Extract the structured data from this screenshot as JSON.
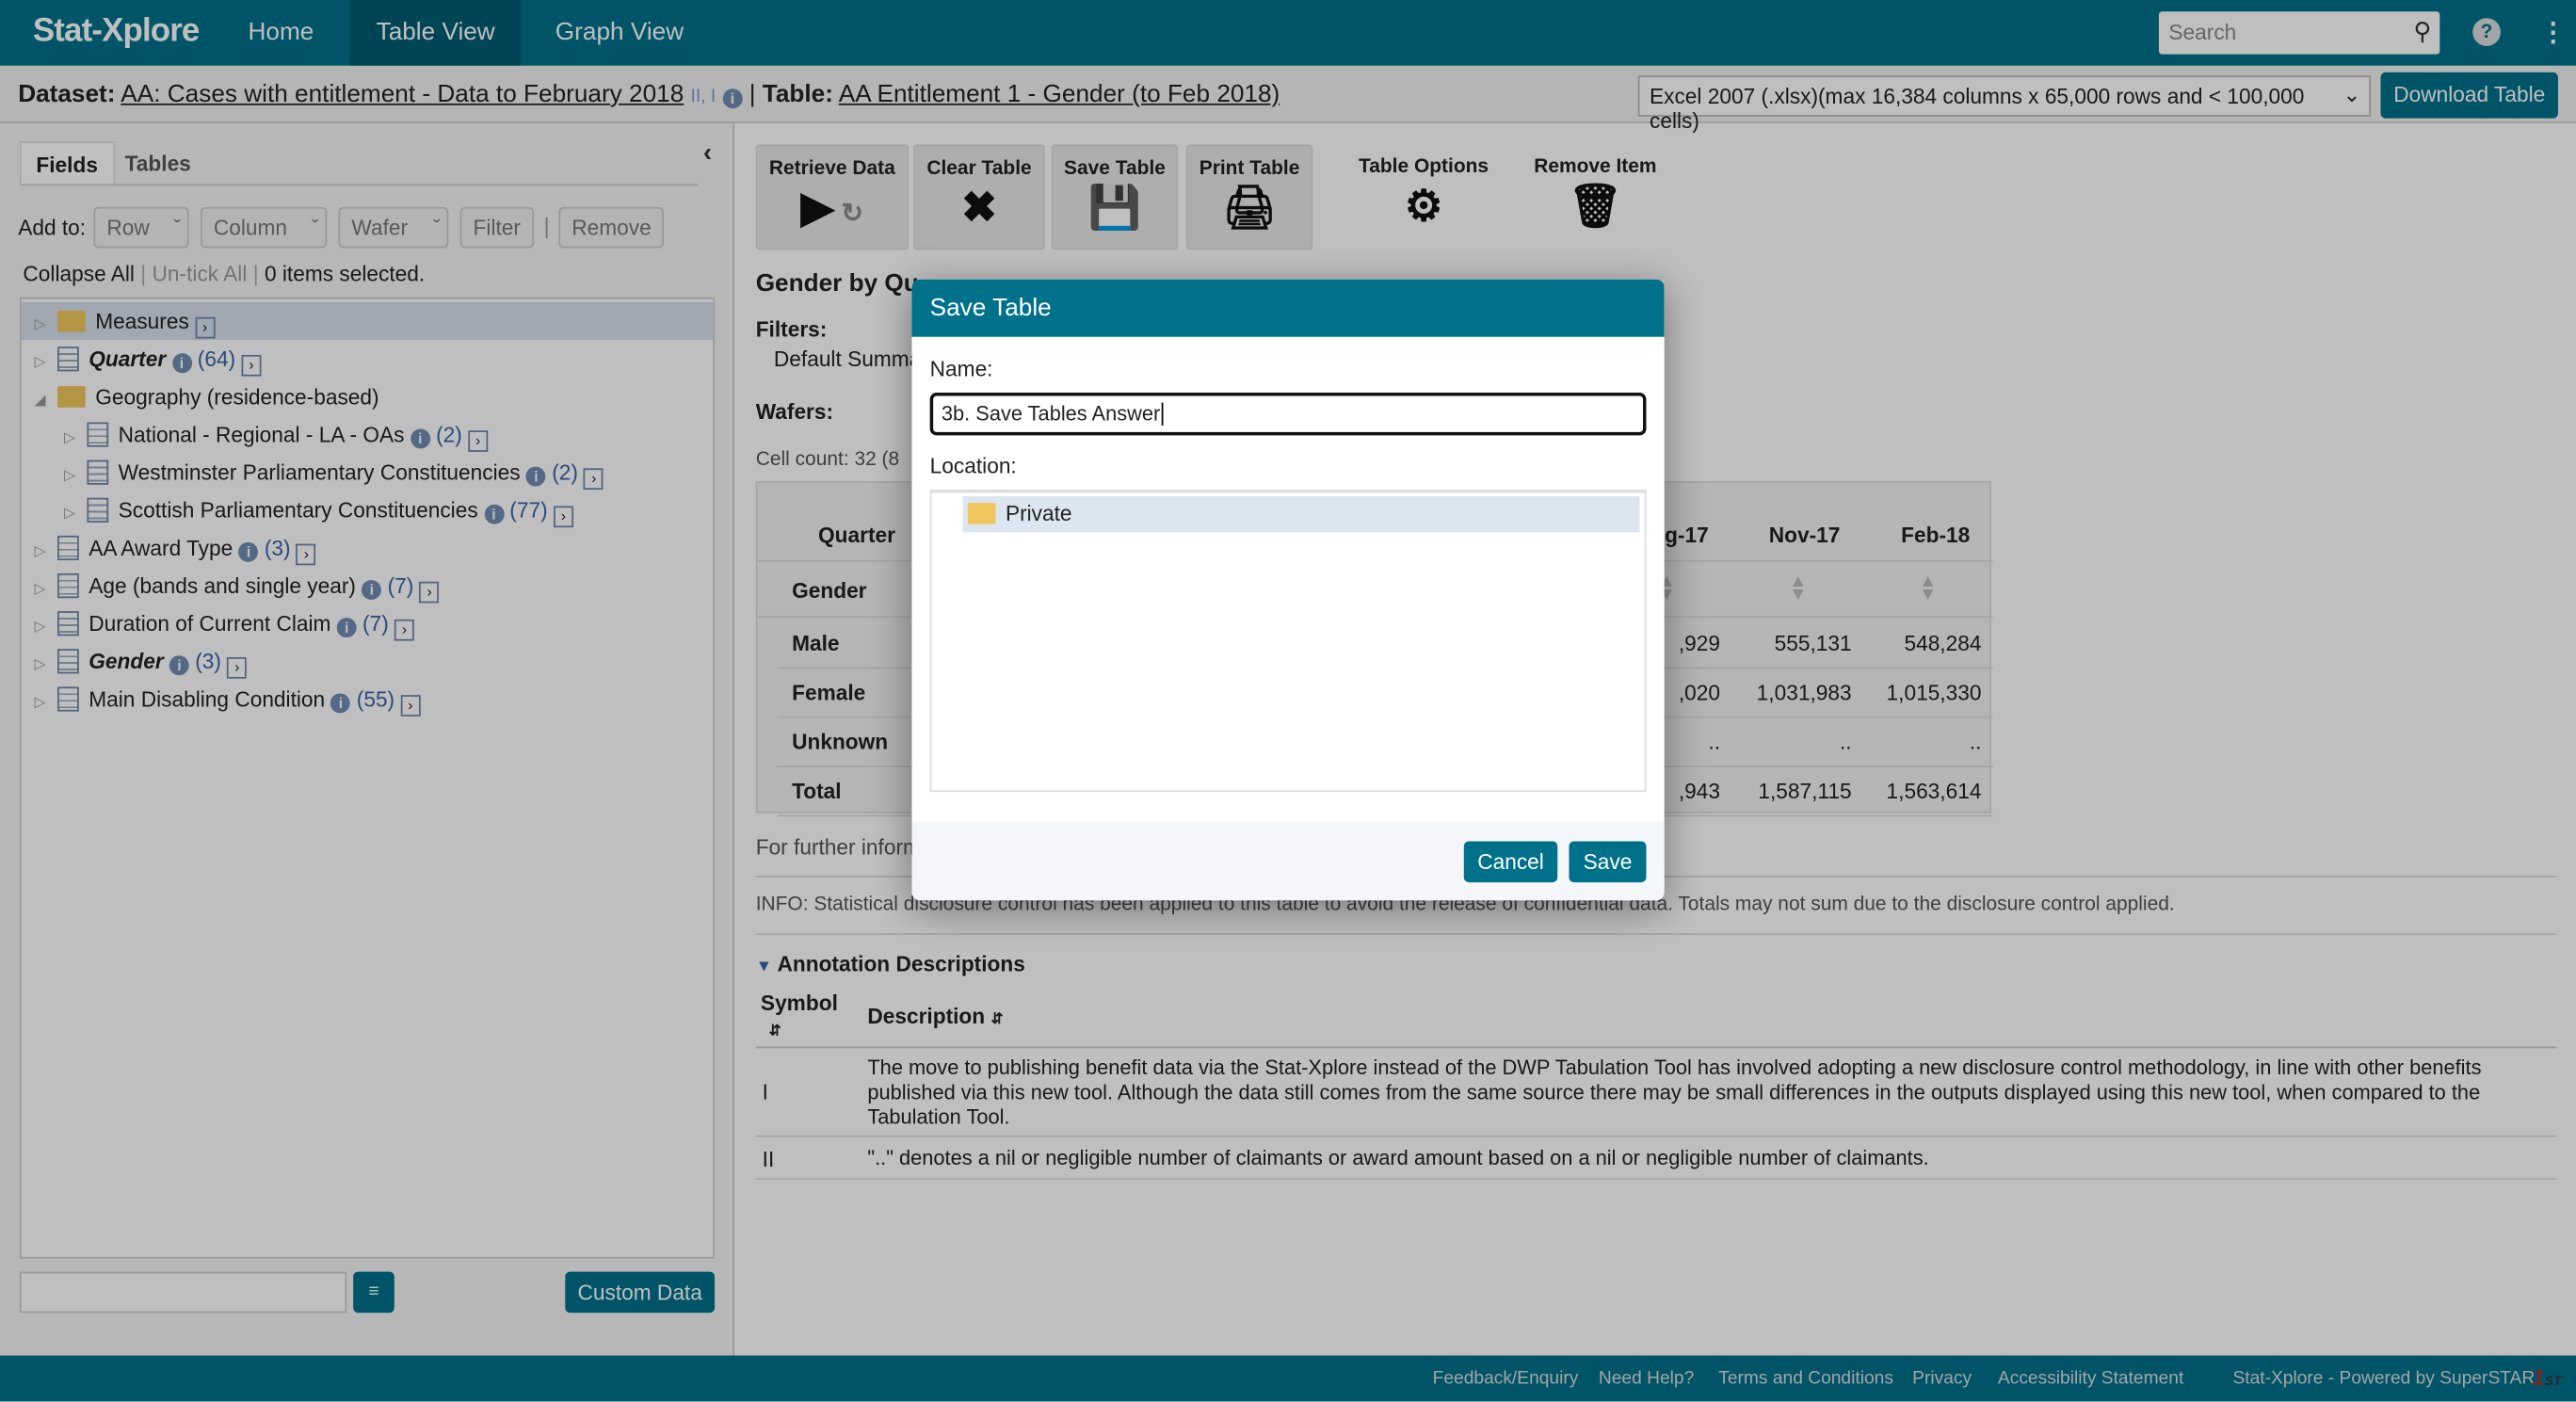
{
  "nav": {
    "logo": "Stat-Xplore",
    "items": [
      "Home",
      "Table View",
      "Graph View"
    ],
    "active": "Table View",
    "search_placeholder": "Search"
  },
  "dataset": {
    "label": "Dataset:",
    "name": "AA: Cases with entitlement - Data to February 2018",
    "annotations": "II, I",
    "table_label": "Table:",
    "table_name": "AA Entitlement 1 - Gender (to Feb 2018)",
    "format": "Excel 2007 (.xlsx)(max 16,384 columns x 65,000 rows and < 100,000 cells)",
    "download": "Download Table"
  },
  "left": {
    "tabs": [
      "Fields",
      "Tables"
    ],
    "add_to": "Add to:",
    "row": "Row",
    "column": "Column",
    "wafer": "Wafer",
    "filter": "Filter",
    "remove": "Remove",
    "collapse_all": "Collapse All",
    "untick_all": "Un-tick All",
    "selected": "0 items selected.",
    "custom_data": "Custom Data",
    "tree": [
      {
        "label": "Measures",
        "type": "measures",
        "level": 0,
        "count": "",
        "info": false,
        "bold": false
      },
      {
        "label": "Quarter",
        "type": "field",
        "level": 0,
        "count": "(64)",
        "info": true,
        "bold": true
      },
      {
        "label": "Geography (residence-based)",
        "type": "folder",
        "level": 0,
        "count": "",
        "info": false,
        "bold": false,
        "expanded": true
      },
      {
        "label": "National - Regional - LA - OAs",
        "type": "field",
        "level": 1,
        "count": "(2)",
        "info": true,
        "bold": false
      },
      {
        "label": "Westminster Parliamentary Constituencies",
        "type": "field",
        "level": 1,
        "count": "(2)",
        "info": true,
        "bold": false
      },
      {
        "label": "Scottish Parliamentary Constituencies",
        "type": "field",
        "level": 1,
        "count": "(77)",
        "info": true,
        "bold": false
      },
      {
        "label": "AA Award Type",
        "type": "field",
        "level": 0,
        "count": "(3)",
        "info": true,
        "bold": false
      },
      {
        "label": "Age (bands and single year)",
        "type": "field",
        "level": 0,
        "count": "(7)",
        "info": true,
        "bold": false
      },
      {
        "label": "Duration of Current Claim",
        "type": "field",
        "level": 0,
        "count": "(7)",
        "info": true,
        "bold": false
      },
      {
        "label": "Gender",
        "type": "field",
        "level": 0,
        "count": "(3)",
        "info": true,
        "bold": true
      },
      {
        "label": "Main Disabling Condition",
        "type": "field",
        "level": 0,
        "count": "(55)",
        "info": true,
        "bold": false
      }
    ]
  },
  "toolbar": [
    "Retrieve Data",
    "Clear Table",
    "Save Table",
    "Print Table",
    "Table Options",
    "Remove Item"
  ],
  "main": {
    "title": "Gender by Qu",
    "filters_label": "Filters:",
    "filters_value": "Default Summa",
    "wafers_label": "Wafers:",
    "cell_count": "Cell count: 32 (8",
    "table": {
      "col_header": "Quarter",
      "row_header": "Gender",
      "columns": [
        "g-17",
        "Nov-17",
        "Feb-18"
      ],
      "rows": [
        {
          "label": "Male",
          "values": [
            ",929",
            "555,131",
            "548,284"
          ]
        },
        {
          "label": "Female",
          "values": [
            ",020",
            "1,031,983",
            "1,015,330"
          ]
        },
        {
          "label": "Unknown",
          "values": [
            "..",
            "..",
            ".."
          ]
        },
        {
          "label": "Total",
          "values": [
            ",943",
            "1,587,115",
            "1,563,614"
          ]
        }
      ]
    },
    "further": "For further inform",
    "info": "INFO: Statistical disclosure control has been applied to this table to avoid the release of confidential data. Totals may not sum due to the disclosure control applied.",
    "annotations_title": "Annotation Descriptions",
    "symbol_header": "Symbol",
    "description_header": "Description",
    "annotations": [
      {
        "symbol": "I",
        "text": "The move to publishing benefit data via the Stat-Xplore instead of the DWP Tabulation Tool has involved adopting a new disclosure control methodology, in line with other benefits published via this new tool. Although the data still comes from the same source there may be small differences in the outputs displayed using this new tool, when compared to the Tabulation Tool."
      },
      {
        "symbol": "II",
        "text": "\"..\" denotes a nil or negligible number of claimants or award amount based on a nil or negligible number of claimants."
      }
    ]
  },
  "dialog": {
    "title": "Save Table",
    "name_label": "Name:",
    "name_value": "3b. Save Tables Answer",
    "location_label": "Location:",
    "location_item": "Private",
    "cancel": "Cancel",
    "save": "Save"
  },
  "footer": {
    "links": [
      "Feedback/Enquiry",
      "Need Help?",
      "Terms and Conditions",
      "Privacy",
      "Accessibility Statement"
    ],
    "powered": "Stat-Xplore - Powered by SuperSTAR"
  },
  "colors": {
    "brand": "#00718b",
    "selection": "#dce6f0"
  }
}
